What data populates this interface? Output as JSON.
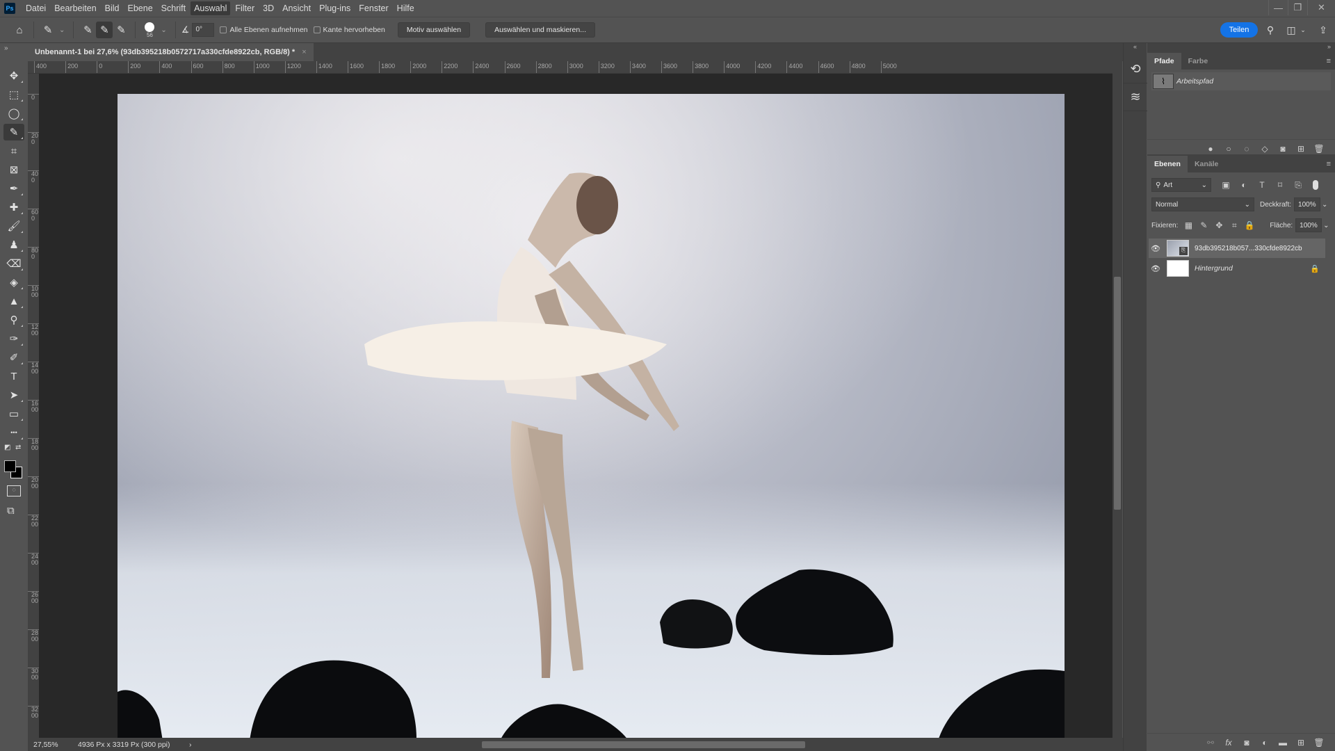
{
  "app": {
    "logo": "Ps",
    "menu": [
      "Datei",
      "Bearbeiten",
      "Bild",
      "Ebene",
      "Schrift",
      "Auswahl",
      "Filter",
      "3D",
      "Ansicht",
      "Plug-ins",
      "Fenster",
      "Hilfe"
    ],
    "active_menu": "Auswahl",
    "window_controls": {
      "minimize": "—",
      "restore": "❐",
      "close": "✕"
    }
  },
  "options_bar": {
    "brush_size": "56",
    "angle": "0°",
    "sample_all_layers": {
      "label": "Alle Ebenen aufnehmen",
      "checked": false
    },
    "enhance_edge": {
      "label": "Kante hervorheben",
      "checked": false
    },
    "select_subject": "Motiv auswählen",
    "select_and_mask": "Auswählen und maskieren...",
    "share": "Teilen"
  },
  "document": {
    "tab_title": "Unbenannt-1 bei 27,6% (93db395218b0572717a330cfde8922cb, RGB/8) *",
    "close": "×"
  },
  "rulers": {
    "horizontal": [
      "400",
      "200",
      "0",
      "200",
      "400",
      "600",
      "800",
      "1000",
      "1200",
      "1400",
      "1600",
      "1800",
      "2000",
      "2200",
      "2400",
      "2600",
      "2800",
      "3000",
      "3200",
      "3400",
      "3600",
      "3800",
      "4000",
      "4200",
      "4400",
      "4600",
      "4800",
      "5000"
    ],
    "vertical": [
      "0",
      "200",
      "400",
      "600",
      "800",
      "1000",
      "1200",
      "1400",
      "1600",
      "1800",
      "2000",
      "2200",
      "2400",
      "2600",
      "2800",
      "3000",
      "3200"
    ]
  },
  "tools": [
    {
      "name": "move-tool",
      "glyph": "✥"
    },
    {
      "name": "marquee-tool",
      "glyph": "⬚"
    },
    {
      "name": "lasso-tool",
      "glyph": "◯"
    },
    {
      "name": "quick-selection-tool",
      "glyph": "✎",
      "active": true
    },
    {
      "name": "crop-tool",
      "glyph": "⌗"
    },
    {
      "name": "frame-tool",
      "glyph": "⊠"
    },
    {
      "name": "eyedropper-tool",
      "glyph": "✒"
    },
    {
      "name": "healing-brush-tool",
      "glyph": "✚"
    },
    {
      "name": "brush-tool",
      "glyph": "🖌"
    },
    {
      "name": "clone-stamp-tool",
      "glyph": "♟"
    },
    {
      "name": "eraser-tool",
      "glyph": "⌫"
    },
    {
      "name": "paint-bucket-tool",
      "glyph": "◈"
    },
    {
      "name": "blur-tool",
      "glyph": "▲"
    },
    {
      "name": "dodge-tool",
      "glyph": "⚲"
    },
    {
      "name": "pen-tool",
      "glyph": "✑"
    },
    {
      "name": "content-aware-pen-tool",
      "glyph": "✐"
    },
    {
      "name": "type-tool",
      "glyph": "T"
    },
    {
      "name": "path-selection-tool",
      "glyph": "➤"
    },
    {
      "name": "rectangle-tool",
      "glyph": "▭"
    },
    {
      "name": "more-tools",
      "glyph": "•••"
    }
  ],
  "colors": {
    "foreground": "#000000",
    "background": "#000000",
    "accent": "#1473e6"
  },
  "status": {
    "zoom": "27,55%",
    "doc_info": "4936 Px x 3319 Px (300 ppi)",
    "arrow": "›"
  },
  "paths_panel": {
    "tabs": [
      "Pfade",
      "Farbe"
    ],
    "active_tab": "Pfade",
    "items": [
      {
        "name": "Arbeitspfad"
      }
    ],
    "footer_icons": [
      "fill-path-icon",
      "stroke-path-icon",
      "load-selection-icon",
      "make-path-icon",
      "add-mask-icon",
      "new-path-icon",
      "delete-icon"
    ]
  },
  "layers_panel": {
    "tabs": [
      "Ebenen",
      "Kanäle"
    ],
    "active_tab": "Ebenen",
    "filter_kind": "Art",
    "blend_mode": "Normal",
    "opacity_label": "Deckkraft:",
    "opacity": "100%",
    "lock_label": "Fixieren:",
    "fill_label": "Fläche:",
    "fill": "100%",
    "layers": [
      {
        "name": "93db395218b057...330cfde8922cb",
        "visible": true,
        "selected": true,
        "smart_object": true
      },
      {
        "name": "Hintergrund",
        "visible": true,
        "locked": true
      }
    ],
    "footer_icons": [
      "link-icon",
      "fx-icon",
      "mask-icon",
      "adjustment-icon",
      "group-icon",
      "new-layer-icon",
      "delete-icon"
    ],
    "footer_glyphs": [
      "⚯",
      "fx",
      "◙",
      "◐",
      "▬",
      "⊞",
      "🗑"
    ]
  }
}
